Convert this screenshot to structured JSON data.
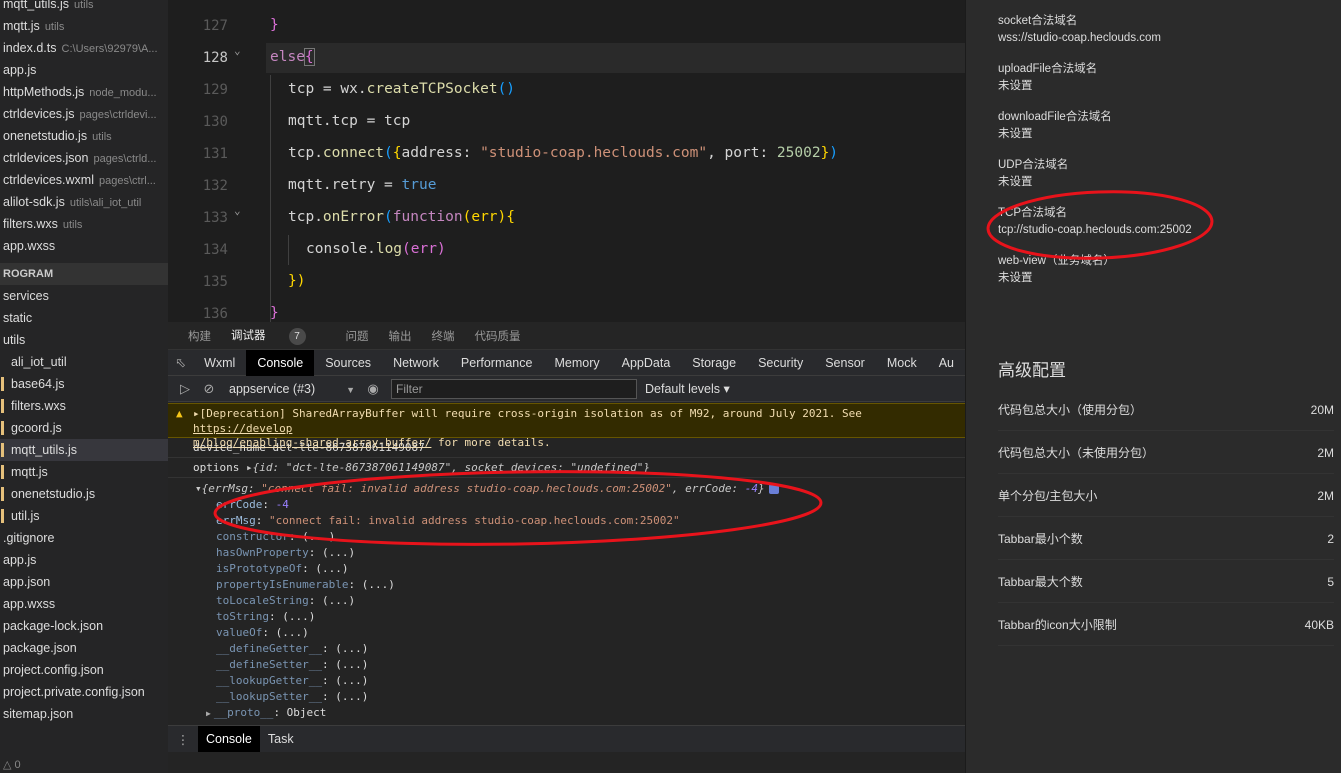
{
  "explorer": {
    "top_files": [
      {
        "name": "mqtt_utils.js",
        "hint": "utils"
      },
      {
        "name": "mqtt.js",
        "hint": "utils"
      },
      {
        "name": "index.d.ts",
        "hint": "C:\\Users\\92979\\A..."
      },
      {
        "name": "app.js",
        "hint": ""
      },
      {
        "name": "httpMethods.js",
        "hint": "node_modu..."
      },
      {
        "name": "ctrldevices.js",
        "hint": "pages\\ctrldevi..."
      },
      {
        "name": "onenetstudio.js",
        "hint": "utils"
      },
      {
        "name": "ctrldevices.json",
        "hint": "pages\\ctrld..."
      },
      {
        "name": "ctrldevices.wxml",
        "hint": "pages\\ctrl..."
      },
      {
        "name": "alilot-sdk.js",
        "hint": "utils\\ali_iot_util"
      },
      {
        "name": "filters.wxs",
        "hint": "utils"
      },
      {
        "name": "app.wxss",
        "hint": ""
      }
    ],
    "section_title": "ROGRAM",
    "tree": [
      {
        "name": "services",
        "indent": false,
        "mark": false,
        "selected": false
      },
      {
        "name": "static",
        "indent": false,
        "mark": false,
        "selected": false
      },
      {
        "name": "utils",
        "indent": false,
        "mark": false,
        "selected": false
      },
      {
        "name": "ali_iot_util",
        "indent": true,
        "mark": false,
        "selected": false
      },
      {
        "name": "base64.js",
        "indent": true,
        "mark": true,
        "selected": false
      },
      {
        "name": "filters.wxs",
        "indent": true,
        "mark": true,
        "selected": false
      },
      {
        "name": "gcoord.js",
        "indent": true,
        "mark": true,
        "selected": false
      },
      {
        "name": "mqtt_utils.js",
        "indent": true,
        "mark": true,
        "selected": true
      },
      {
        "name": "mqtt.js",
        "indent": true,
        "mark": true,
        "selected": false
      },
      {
        "name": "onenetstudio.js",
        "indent": true,
        "mark": true,
        "selected": false
      },
      {
        "name": "util.js",
        "indent": true,
        "mark": true,
        "selected": false
      },
      {
        "name": ".gitignore",
        "indent": false,
        "mark": false,
        "selected": false
      },
      {
        "name": "app.js",
        "indent": false,
        "mark": false,
        "selected": false
      },
      {
        "name": "app.json",
        "indent": false,
        "mark": false,
        "selected": false
      },
      {
        "name": "app.wxss",
        "indent": false,
        "mark": false,
        "selected": false
      },
      {
        "name": "package-lock.json",
        "indent": false,
        "mark": false,
        "selected": false
      },
      {
        "name": "package.json",
        "indent": false,
        "mark": false,
        "selected": false
      },
      {
        "name": "project.config.json",
        "indent": false,
        "mark": false,
        "selected": false
      },
      {
        "name": "project.private.config.json",
        "indent": false,
        "mark": false,
        "selected": false
      },
      {
        "name": "sitemap.json",
        "indent": false,
        "mark": false,
        "selected": false
      }
    ],
    "status": "△ 0"
  },
  "editor": {
    "line_numbers": [
      "127",
      "128",
      "129",
      "130",
      "131",
      "132",
      "133",
      "134",
      "135",
      "136"
    ],
    "current_line": "128",
    "tokens": {
      "close_brace": "}",
      "else": "else",
      "open_brace": "{",
      "tcp": "tcp",
      "eq": " = ",
      "wx": "wx.",
      "create": "createTCPSocket",
      "parens": "()",
      "mqtt_tcp": "mqtt.tcp",
      "tcp_connect_obj": "tcp.",
      "connect": "connect",
      "lp": "(",
      "lb": "{",
      "address_key": "address: ",
      "address_val": "\"studio-coap.heclouds.com\"",
      "port_key": ", port: ",
      "port_val": "25002",
      "rb": "}",
      "rp": ")",
      "mqtt_retry": "mqtt.retry",
      "true": "true",
      "onerror": "onError",
      "function": "function",
      "err_param": "(err)",
      "console_log": "console.",
      "log": "log",
      "err_arg": "(err)",
      "close_cb": "})"
    }
  },
  "panel": {
    "tabs": [
      "构建",
      "调试器",
      "问题",
      "输出",
      "终端",
      "代码质量"
    ],
    "debugger_badge": "7",
    "devtools_tabs": [
      "Wxml",
      "Console",
      "Sources",
      "Network",
      "Performance",
      "Memory",
      "AppData",
      "Storage",
      "Security",
      "Sensor",
      "Mock",
      "Au"
    ],
    "context": "appservice (#3)",
    "filter_placeholder": "Filter",
    "levels": "Default levels ▾",
    "warning_line1": "▸[Deprecation] SharedArrayBuffer will require cross-origin isolation as of M92, around July 2021. See ",
    "warning_link1": "https://develop",
    "warning_link2": "m/blog/enabling-shared-array-buffer/",
    "warning_line2": " for more details.",
    "device_line": "device_name dct-lte-867387061149087",
    "options_label": "options ",
    "options_value": "▸{id: \"dct-lte-867387061149087\", socket_devices: \"undefined\"}",
    "err_summary_prefix": "▾{errMsg: ",
    "err_summary_msg": "\"connect fail: invalid address studio-coap.heclouds.com:25002\"",
    "err_summary_mid": ", errCode: ",
    "err_summary_code": "-4",
    "err_summary_end": "}",
    "errcode_key": "errCode",
    "errcode_val": "-4",
    "errmsg_key": "errMsg",
    "errmsg_val": "\"connect fail: invalid address studio-coap.heclouds.com:25002\"",
    "proto_props": [
      "constructor",
      "hasOwnProperty",
      "isPrototypeOf",
      "propertyIsEnumerable",
      "toLocaleString",
      "toString",
      "valueOf",
      "__defineGetter__",
      "__defineSetter__",
      "__lookupGetter__",
      "__lookupSetter__"
    ],
    "proto_val": ": (...)",
    "proto_key": "__proto__",
    "proto_obj": ": Object",
    "drawer_tabs": [
      "Console",
      "Task"
    ]
  },
  "settings": {
    "domains": [
      {
        "label": "socket合法域名",
        "value": "wss://studio-coap.heclouds.com"
      },
      {
        "label": "uploadFile合法域名",
        "value": "未设置"
      },
      {
        "label": "downloadFile合法域名",
        "value": "未设置"
      },
      {
        "label": "UDP合法域名",
        "value": "未设置"
      },
      {
        "label": "TCP合法域名",
        "value": "tcp://studio-coap.heclouds.com:25002"
      },
      {
        "label": "web-view（业务域名）",
        "value": "未设置"
      }
    ],
    "advanced_title": "高级配置",
    "configs": [
      {
        "label": "代码包总大小（使用分包）",
        "value": "20M"
      },
      {
        "label": "代码包总大小（未使用分包）",
        "value": "2M"
      },
      {
        "label": "单个分包/主包大小",
        "value": "2M"
      },
      {
        "label": "Tabbar最小个数",
        "value": "2"
      },
      {
        "label": "Tabbar最大个数",
        "value": "5"
      },
      {
        "label": "Tabbar的icon大小限制",
        "value": "40KB"
      }
    ]
  },
  "colors": {
    "annotation": "#e8131b",
    "warning_bg": "#332b00",
    "accent_marker": "#e5c07b"
  }
}
